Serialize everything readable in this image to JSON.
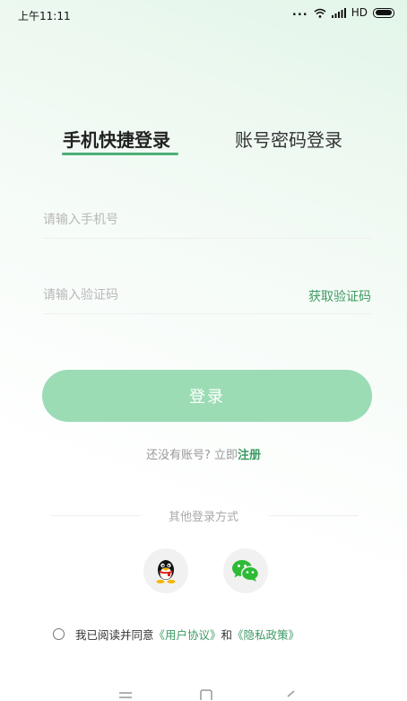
{
  "status_bar": {
    "time": "上午11:11",
    "dots": "...",
    "network": "HD"
  },
  "tabs": {
    "active": "手机快捷登录",
    "inactive": "账号密码登录"
  },
  "form": {
    "phone_placeholder": "请输入手机号",
    "code_placeholder": "请输入验证码",
    "get_code": "获取验证码",
    "login_label": "登录"
  },
  "register": {
    "prompt": "还没有账号? 立即",
    "link": "注册"
  },
  "other_login": {
    "label": "其他登录方式"
  },
  "agreement": {
    "prefix": "我已阅读并同意",
    "user_agreement": "《用户协议》",
    "and": "和",
    "privacy_policy": "《隐私政策》"
  },
  "colors": {
    "accent": "#4caf77",
    "button": "#9bdcb5",
    "link": "#3d9a63"
  },
  "icons": {
    "qq": "qq-penguin-icon",
    "wechat": "wechat-icon"
  }
}
